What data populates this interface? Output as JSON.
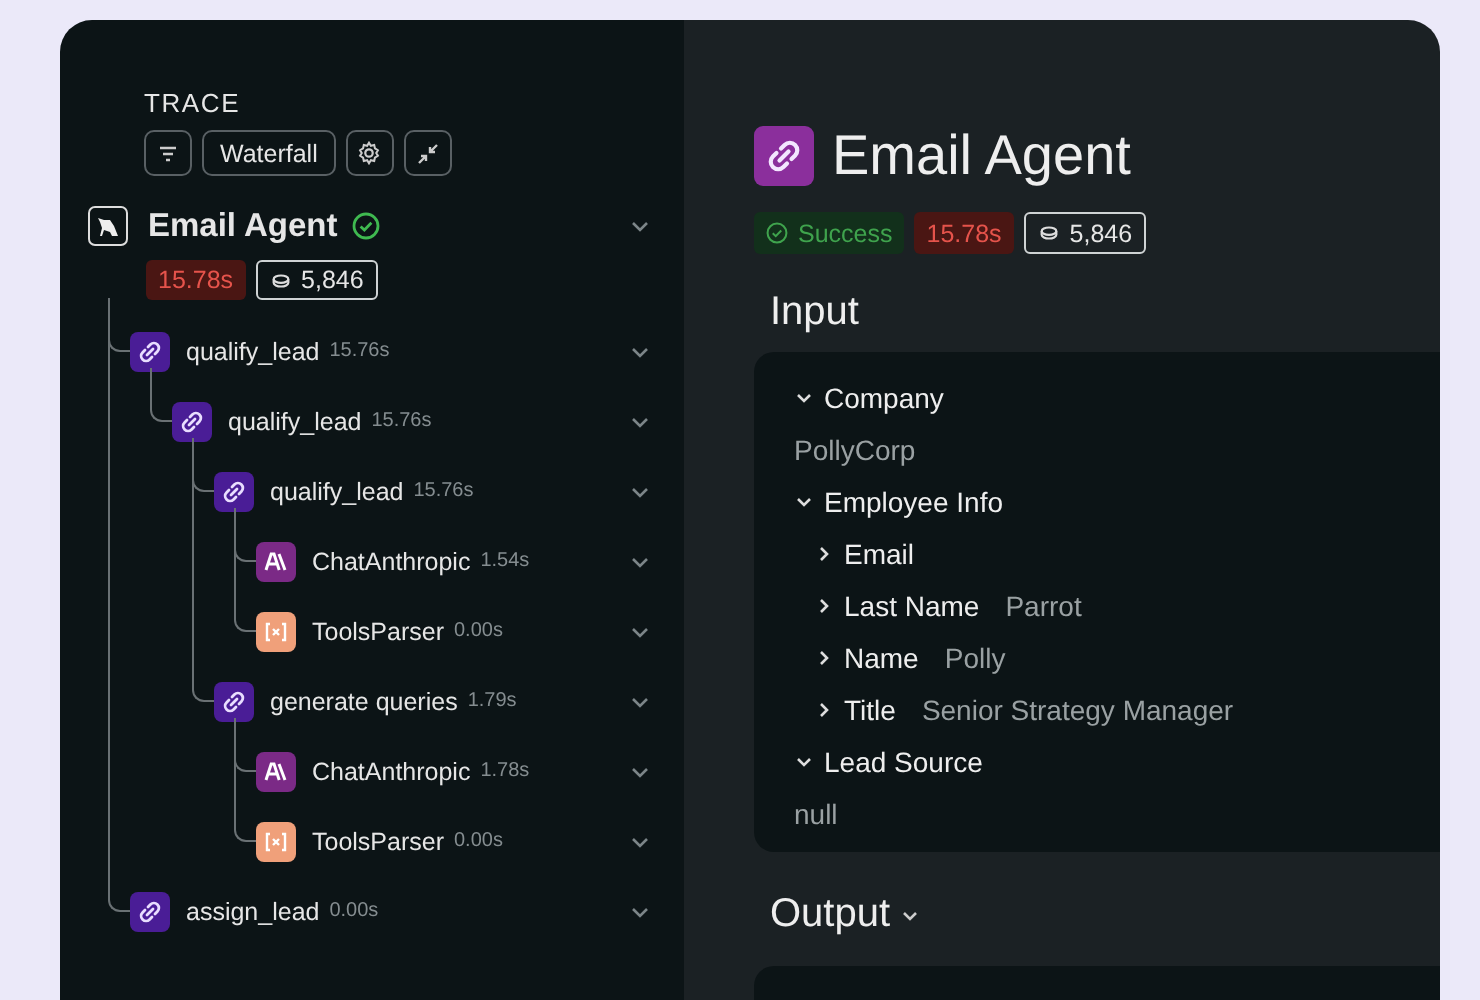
{
  "trace": {
    "heading": "TRACE",
    "view_button": "Waterfall"
  },
  "root": {
    "name": "Email Agent",
    "latency": "15.78s",
    "tokens": "5,846",
    "children": [
      {
        "name": "qualify_lead",
        "time": "15.76s",
        "kind": "chain",
        "children": [
          {
            "name": "qualify_lead",
            "time": "15.76s",
            "kind": "chain",
            "children": [
              {
                "name": "qualify_lead",
                "time": "15.76s",
                "kind": "chain",
                "children": [
                  {
                    "name": "ChatAnthropic",
                    "time": "1.54s",
                    "kind": "llm"
                  },
                  {
                    "name": "ToolsParser",
                    "time": "0.00s",
                    "kind": "parser"
                  }
                ]
              },
              {
                "name": "generate queries",
                "time": "1.79s",
                "kind": "chain",
                "children": [
                  {
                    "name": "ChatAnthropic",
                    "time": "1.78s",
                    "kind": "llm"
                  },
                  {
                    "name": "ToolsParser",
                    "time": "0.00s",
                    "kind": "parser"
                  }
                ]
              }
            ]
          }
        ]
      },
      {
        "name": "assign_lead",
        "time": "0.00s",
        "kind": "chain"
      }
    ]
  },
  "detail": {
    "title": "Email Agent",
    "status": "Success",
    "latency": "15.78s",
    "tokens": "5,846",
    "input_heading": "Input",
    "input": [
      {
        "key": "Company",
        "expanded": true,
        "value": "PollyCorp"
      },
      {
        "key": "Employee Info",
        "expanded": true,
        "children": [
          {
            "key": "Email",
            "expanded": false
          },
          {
            "key": "Last Name",
            "expanded": false,
            "value": "Parrot"
          },
          {
            "key": "Name",
            "expanded": false,
            "value": "Polly"
          },
          {
            "key": "Title",
            "expanded": false,
            "value": "Senior Strategy Manager"
          }
        ]
      },
      {
        "key": "Lead Source",
        "expanded": true,
        "value": "null"
      }
    ],
    "output_heading": "Output"
  }
}
